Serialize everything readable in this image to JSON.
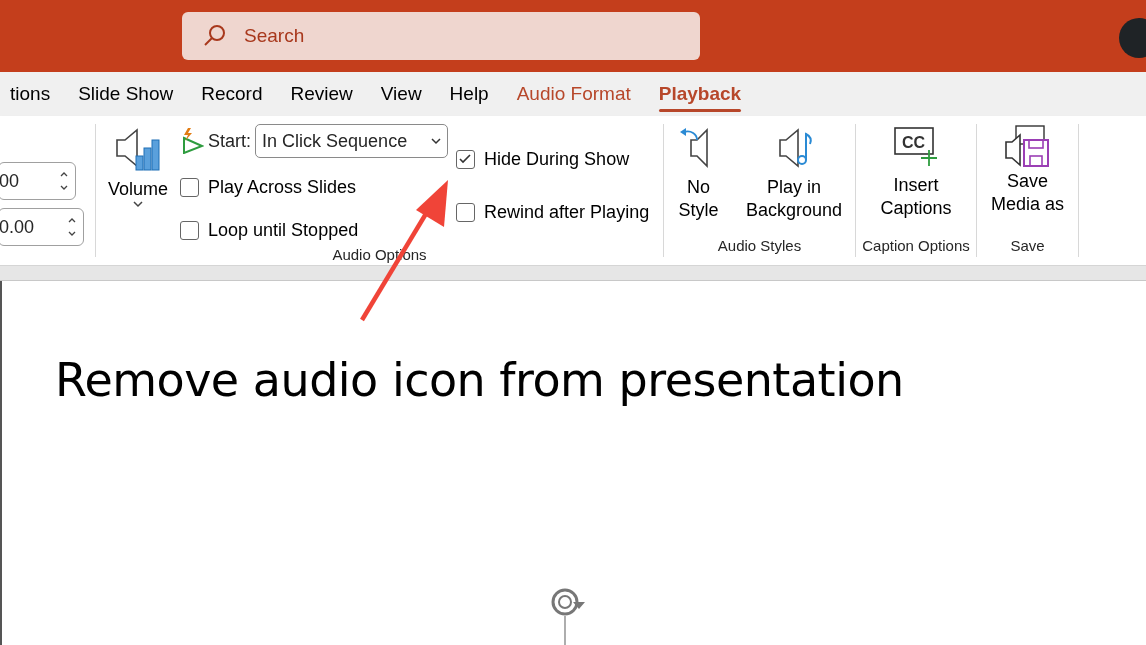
{
  "title_bar": {
    "search": {
      "placeholder": "Search"
    }
  },
  "tabs": [
    {
      "label": "tions",
      "kind": "normal",
      "selected": false
    },
    {
      "label": "Slide Show",
      "kind": "normal",
      "selected": false
    },
    {
      "label": "Record",
      "kind": "normal",
      "selected": false
    },
    {
      "label": "Review",
      "kind": "normal",
      "selected": false
    },
    {
      "label": "View",
      "kind": "normal",
      "selected": false
    },
    {
      "label": "Help",
      "kind": "normal",
      "selected": false
    },
    {
      "label": "Audio Format",
      "kind": "contextual",
      "selected": false
    },
    {
      "label": "Playback",
      "kind": "contextual",
      "selected": true
    }
  ],
  "ribbon": {
    "timing_fields": [
      {
        "value": "00"
      },
      {
        "value": "0.00"
      }
    ],
    "audio_options": {
      "volume_label": "Volume",
      "start_label": "Start:",
      "start_value": "In Click Sequence",
      "checkboxes": [
        {
          "label": "Play Across Slides",
          "checked": false
        },
        {
          "label": "Loop until Stopped",
          "checked": false
        },
        {
          "label": "Hide During Show",
          "checked": true
        },
        {
          "label": "Rewind after Playing",
          "checked": false
        }
      ],
      "group_label": "Audio Options"
    },
    "audio_styles": {
      "buttons": [
        {
          "label": "No Style",
          "kind": "no-style"
        },
        {
          "label": "Play in Background",
          "kind": "background"
        }
      ],
      "group_label": "Audio Styles"
    },
    "caption_options": {
      "icon_text": "CC",
      "button": "Insert Captions",
      "group_label": "Caption Options"
    },
    "save": {
      "button": "Save Media as",
      "group_label": "Save"
    }
  },
  "slide": {
    "title": "Remove audio icon from presentation"
  }
}
